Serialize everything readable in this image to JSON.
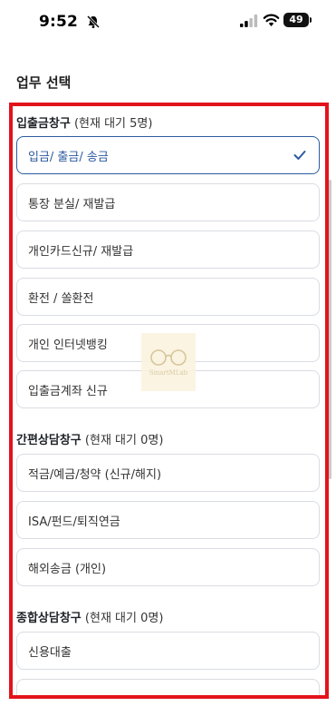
{
  "status_bar": {
    "time": "9:52",
    "battery": "49"
  },
  "page_title": "업무 선택",
  "sections": [
    {
      "title": "입출금창구",
      "wait": "(현재 대기 5명)",
      "options": [
        {
          "label": "입금/ 출금/ 송금",
          "selected": true
        },
        {
          "label": "통장 분실/ 재발급"
        },
        {
          "label": "개인카드신규/ 재발급"
        },
        {
          "label": "환전 / 쏠환전"
        },
        {
          "label": "개인 인터넷뱅킹"
        },
        {
          "label": "입출금계좌 신규"
        }
      ]
    },
    {
      "title": "간편상담창구",
      "wait": "(현재 대기 0명)",
      "options": [
        {
          "label": "적금/예금/청약 (신규/해지)"
        },
        {
          "label": "ISA/펀드/퇴직연금"
        },
        {
          "label": "해외송금 (개인)"
        }
      ]
    },
    {
      "title": "종합상담창구",
      "wait": "(현재 대기 0명)",
      "options": [
        {
          "label": "신용대출"
        },
        {
          "label": ""
        }
      ]
    }
  ],
  "watermark": "SmartMLab",
  "colors": {
    "accent": "#2c5aa0",
    "highlight": "#e3131b"
  }
}
